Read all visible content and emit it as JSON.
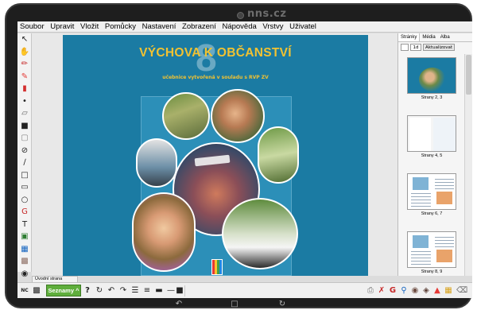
{
  "brand": {
    "watermark": "nns.cz"
  },
  "menu": [
    "Soubor",
    "Upravit",
    "Vložit",
    "Pomůcky",
    "Nastavení",
    "Zobrazení",
    "Nápověda",
    "Vrstvy",
    "Uživatel"
  ],
  "cover": {
    "title": "VÝCHOVA K OBČANSTVÍ",
    "grade": "8",
    "subtitle": "učebnice vytvořená v souladu s RVP ZV"
  },
  "right_panel": {
    "tabs": [
      "Stránky",
      "Média",
      "Alba"
    ],
    "active_tab": "Stránky",
    "page_input": "1d",
    "refresh_label": "Aktualizovat",
    "pages": [
      {
        "label": "Strany 2, 3",
        "style": "cover"
      },
      {
        "label": "Strany 4, 5",
        "style": "text"
      },
      {
        "label": "Strany 6, 7",
        "style": "pic"
      },
      {
        "label": "Strany 8, 9",
        "style": "pic"
      }
    ]
  },
  "status": {
    "page_name": "Úvodní strana"
  },
  "bottom_bar": {
    "lists_label": "Seznamy ^",
    "nc_label": "NC"
  },
  "colors": {
    "cover_blue": "#1b7ba3",
    "title_yellow": "#f1c232",
    "lists_green": "#5fae3c"
  }
}
